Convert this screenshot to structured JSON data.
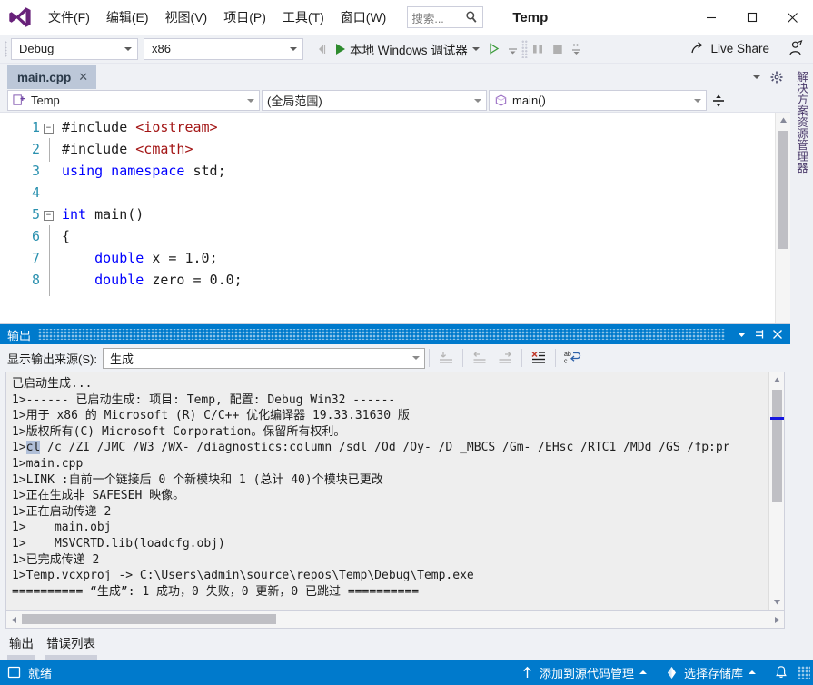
{
  "window": {
    "title": "Temp",
    "logo_icon": "visual-studio-logo",
    "minimize_icon": "minimize-icon",
    "maximize_icon": "maximize-icon",
    "close_icon": "close-icon"
  },
  "menu": {
    "items": [
      {
        "label": "文件(F)",
        "name": "menu-file"
      },
      {
        "label": "编辑(E)",
        "name": "menu-edit"
      },
      {
        "label": "视图(V)",
        "name": "menu-view"
      },
      {
        "label": "项目(P)",
        "name": "menu-project"
      },
      {
        "label": "工具(T)",
        "name": "menu-tools"
      },
      {
        "label": "窗口(W)",
        "name": "menu-window"
      }
    ]
  },
  "search": {
    "placeholder": "搜索...",
    "icon": "search-icon"
  },
  "toolbar": {
    "configuration": "Debug",
    "platform": "x86",
    "run_label": "本地 Windows 调试器",
    "live_share_label": "Live Share",
    "icons": {
      "nav_back": "navigate-back-icon",
      "start_debug": "start-debug-play-icon",
      "start_no_debug": "start-without-debugging-icon",
      "pause": "pause-icon",
      "stop": "stop-icon",
      "live_share": "live-share-icon",
      "feedback": "send-feedback-icon"
    }
  },
  "editor": {
    "tab": {
      "label": "main.cpp",
      "close": "✕"
    },
    "nav": {
      "project": "Temp",
      "scope": "(全局范围)",
      "member": "main()",
      "project_icon": "cpp-project-icon",
      "member_icon": "method-icon",
      "split_icon": "split-editor-icon"
    },
    "lines": [
      {
        "num": "1",
        "fold": "−",
        "tokens": [
          {
            "t": "#include ",
            "c": "plain"
          },
          {
            "t": "<iostream>",
            "c": "inc"
          }
        ]
      },
      {
        "num": "2",
        "fold": "",
        "tokens": [
          {
            "t": "#include ",
            "c": "plain"
          },
          {
            "t": "<cmath>",
            "c": "inc"
          }
        ]
      },
      {
        "num": "3",
        "fold": "",
        "tokens": [
          {
            "t": "using namespace",
            "c": "kw"
          },
          {
            "t": " std;",
            "c": "plain"
          }
        ]
      },
      {
        "num": "4",
        "fold": "",
        "tokens": []
      },
      {
        "num": "5",
        "fold": "−",
        "tokens": [
          {
            "t": "int",
            "c": "kw"
          },
          {
            "t": " main()",
            "c": "plain"
          }
        ]
      },
      {
        "num": "6",
        "fold": "",
        "tokens": [
          {
            "t": "{",
            "c": "plain"
          }
        ]
      },
      {
        "num": "7",
        "fold": "",
        "tokens": [
          {
            "t": "    ",
            "c": "plain"
          },
          {
            "t": "double",
            "c": "kw"
          },
          {
            "t": " x = ",
            "c": "plain"
          },
          {
            "t": "1.0",
            "c": "num"
          },
          {
            "t": ";",
            "c": "plain"
          }
        ]
      },
      {
        "num": "8",
        "fold": "",
        "tokens": [
          {
            "t": "    ",
            "c": "plain"
          },
          {
            "t": "double",
            "c": "kw"
          },
          {
            "t": " zero = ",
            "c": "plain"
          },
          {
            "t": "0.0",
            "c": "num"
          },
          {
            "t": ";",
            "c": "plain"
          }
        ]
      }
    ]
  },
  "solution_explorer": {
    "vertical_label": "解决方案资源管理器"
  },
  "output": {
    "panel_title": "输出",
    "header_icons": {
      "dropdown": "window-dropdown-icon",
      "pin": "auto-hide-pin-icon",
      "close": "close-icon"
    },
    "source_label": "显示输出来源(S):",
    "source_value": "生成",
    "toolbar_icons": {
      "go_to_message": "go-to-message-icon",
      "prev_message": "previous-message-icon",
      "next_message": "next-message-icon",
      "clear_all": "clear-all-icon",
      "toggle_word_wrap": "word-wrap-icon"
    },
    "lines": [
      [
        {
          "t": "已启动生成...",
          "s": false
        }
      ],
      [
        {
          "t": "1>------ 已启动生成: 项目: Temp, 配置: Debug Win32 ------",
          "s": false
        }
      ],
      [
        {
          "t": "1>用于 x86 的 Microsoft (R) C/C++ 优化编译器 19.33.31630 版",
          "s": false
        }
      ],
      [
        {
          "t": "1>版权所有(C) Microsoft Corporation。保留所有权利。",
          "s": false
        }
      ],
      [
        {
          "t": "1>",
          "s": false
        },
        {
          "t": "cl",
          "s": true
        },
        {
          "t": " /c /ZI /JMC /W3 /WX- /diagnostics:column /sdl /Od /Oy- /D _MBCS /Gm- /EHsc /RTC1 /MDd /GS /fp:pr",
          "s": false
        }
      ],
      [
        {
          "t": "1>main.cpp",
          "s": false
        }
      ],
      [
        {
          "t": "1>LINK :自前一个链接后 0 个新模块和 1 (总计 40)个模块已更改",
          "s": false
        }
      ],
      [
        {
          "t": "1>正在生成非 SAFESEH 映像。",
          "s": false
        }
      ],
      [
        {
          "t": "1>正在启动传递 2",
          "s": false
        }
      ],
      [
        {
          "t": "1>    main.obj",
          "s": false
        }
      ],
      [
        {
          "t": "1>    MSVCRTD.lib(loadcfg.obj)",
          "s": false
        }
      ],
      [
        {
          "t": "1>已完成传递 2",
          "s": false
        }
      ],
      [
        {
          "t": "1>Temp.vcxproj -> C:\\Users\\admin\\source\\repos\\Temp\\Debug\\Temp.exe",
          "s": false
        }
      ],
      [
        {
          "t": "========== “生成”: 1 成功，0 失败，0 更新，0 已跳过 ==========",
          "s": false
        }
      ]
    ]
  },
  "bottom_tabs": [
    {
      "label": "输出",
      "name": "tool-tab-output"
    },
    {
      "label": "错误列表",
      "name": "tool-tab-error-list"
    }
  ],
  "status": {
    "ready": "就绪",
    "ready_icon": "ready-indicator-icon",
    "source_control": "添加到源代码管理",
    "source_control_icon": "add-to-source-control-icon",
    "repository": "选择存储库",
    "repository_icon": "repository-icon",
    "notifications_icon": "notifications-bell-icon"
  },
  "colors": {
    "accent": "#007acc",
    "toolbar_bg": "#eff1f5",
    "tab_active": "#bcc7d8",
    "keyword": "#0000ff",
    "string": "#a31515",
    "linenumber": "#2b91af",
    "selection": "#b0bfd8",
    "scroll_marker": "#1515e0"
  }
}
